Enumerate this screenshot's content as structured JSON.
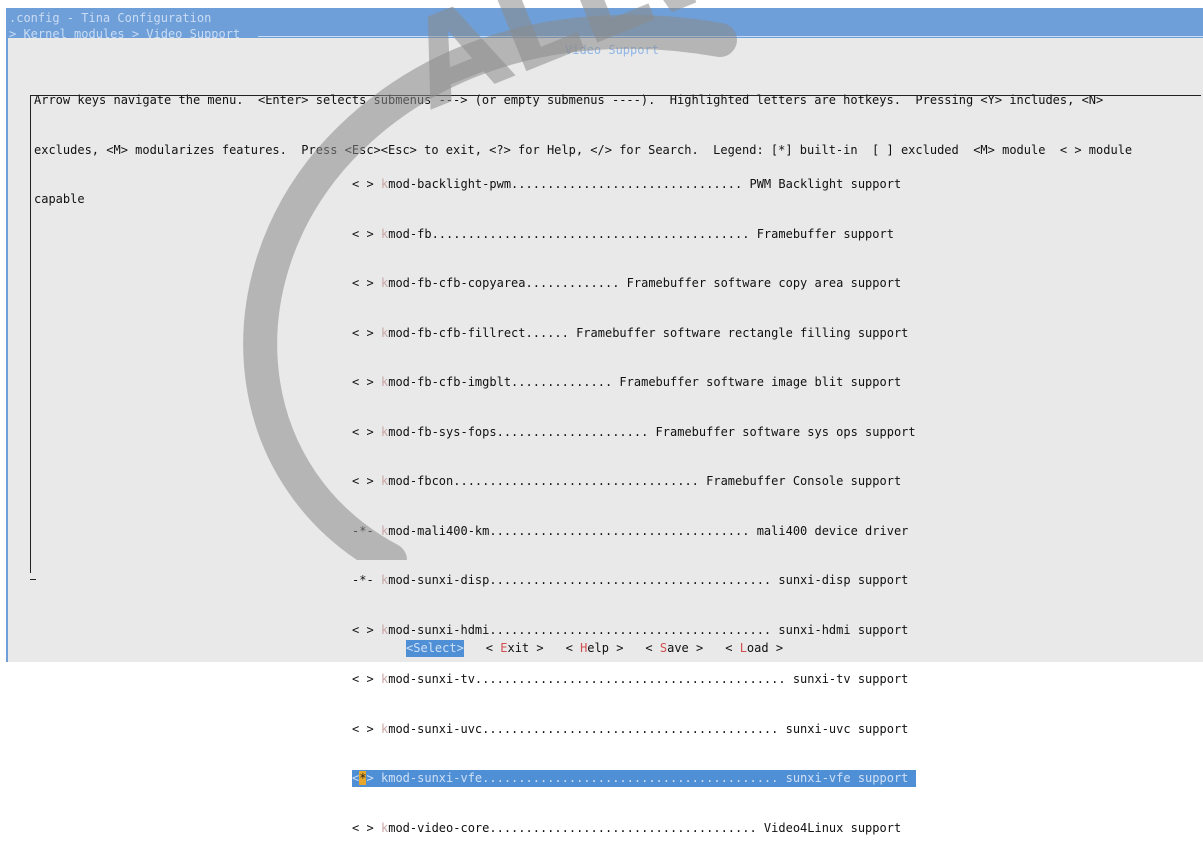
{
  "window": {
    "title": ".config - Tina Configuration",
    "breadcrumb": "> Kernel modules > Video Support "
  },
  "dialog": {
    "title": "Video Support",
    "help_lines": [
      "Arrow keys navigate the menu.  <Enter> selects submenus ---> (or empty submenus ----).  Highlighted letters are hotkeys.  Pressing <Y> includes, <N>",
      "excludes, <M> modularizes features.  Press <Esc><Esc> to exit, <?> for Help, </> for Search.  Legend: [*] built-in  [ ] excluded  <M> module  < > module",
      "capable"
    ]
  },
  "menu": {
    "items": [
      {
        "mark": "< >",
        "first": "k",
        "rest": "mod-backlight-pwm................................ PWM Backlight support",
        "selected": false
      },
      {
        "mark": "< >",
        "first": "k",
        "rest": "mod-fb............................................ Framebuffer support",
        "selected": false
      },
      {
        "mark": "< >",
        "first": "k",
        "rest": "mod-fb-cfb-copyarea............. Framebuffer software copy area support",
        "selected": false
      },
      {
        "mark": "< >",
        "first": "k",
        "rest": "mod-fb-cfb-fillrect...... Framebuffer software rectangle filling support",
        "selected": false
      },
      {
        "mark": "< >",
        "first": "k",
        "rest": "mod-fb-cfb-imgblt.............. Framebuffer software image blit support",
        "selected": false
      },
      {
        "mark": "< >",
        "first": "k",
        "rest": "mod-fb-sys-fops..................... Framebuffer software sys ops support",
        "selected": false
      },
      {
        "mark": "< >",
        "first": "k",
        "rest": "mod-fbcon.................................. Framebuffer Console support",
        "selected": false
      },
      {
        "mark": "-*-",
        "first": "k",
        "rest": "mod-mali400-km.................................... mali400 device driver",
        "selected": false
      },
      {
        "mark": "-*-",
        "first": "k",
        "rest": "mod-sunxi-disp....................................... sunxi-disp support",
        "selected": false
      },
      {
        "mark": "< >",
        "first": "k",
        "rest": "mod-sunxi-hdmi....................................... sunxi-hdmi support",
        "selected": false
      },
      {
        "mark": "< >",
        "first": "k",
        "rest": "mod-sunxi-tv........................................... sunxi-tv support",
        "selected": false
      },
      {
        "mark": "< >",
        "first": "k",
        "rest": "mod-sunxi-uvc......................................... sunxi-uvc support",
        "selected": false
      },
      {
        "mark_left": "<",
        "mark_star": "*",
        "mark_right": ">",
        "first": "k",
        "rest": "mod-sunxi-vfe......................................... sunxi-vfe support",
        "selected": true
      },
      {
        "mark": "< >",
        "first": "k",
        "rest": "mod-video-core..................................... Video4Linux support",
        "selected": false
      }
    ]
  },
  "buttons": [
    {
      "pre": "",
      "hot": "",
      "post": "<Select>",
      "active": true
    },
    {
      "pre": "< ",
      "hot": "E",
      "post": "xit >",
      "active": false
    },
    {
      "pre": "< ",
      "hot": "H",
      "post": "elp >",
      "active": false
    },
    {
      "pre": "< ",
      "hot": "S",
      "post": "ave >",
      "active": false
    },
    {
      "pre": "< ",
      "hot": "L",
      "post": "oad >",
      "active": false
    }
  ],
  "colors": {
    "background": "#6f9fd8",
    "dialog": "#e9e9e9",
    "selection": "#4f8fd6",
    "hotkey": "#d24f4f",
    "cursor": "#e7a72b"
  },
  "watermark": {
    "logo_text": "ALLWINNER",
    "icon": "allwinner-logo-watermark"
  }
}
